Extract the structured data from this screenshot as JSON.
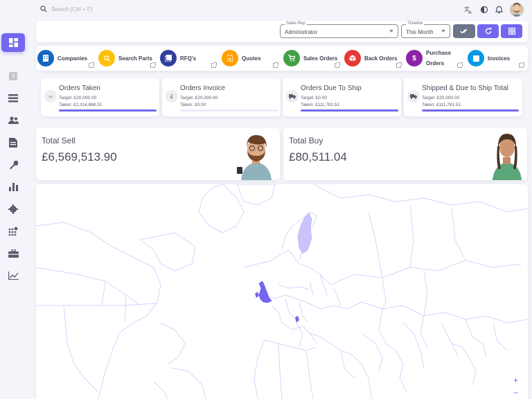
{
  "search": {
    "placeholder": "Search (Ctrl + F)"
  },
  "filters": {
    "sales_rep": {
      "label": "Sales Rep",
      "value": "Administrator"
    },
    "timeline": {
      "label": "Timeline",
      "value": "This Month"
    }
  },
  "quick_links": [
    {
      "label": "Companies",
      "color": "#1565c0",
      "icon": "building-icon"
    },
    {
      "label": "Search Parts",
      "color": "#ffc107",
      "icon": "search-icon"
    },
    {
      "label": "RFQ's",
      "color": "#303f9f",
      "icon": "stack-icon"
    },
    {
      "label": "Quotes",
      "color": "#ff9f00",
      "icon": "document-icon"
    },
    {
      "label": "Sales Orders",
      "color": "#43a047",
      "icon": "cart-icon"
    },
    {
      "label": "Back Orders",
      "color": "#e53935",
      "icon": "box-icon"
    },
    {
      "label": "Purchase Orders",
      "color": "#8e24aa",
      "icon": "dollar-icon"
    },
    {
      "label": "Invoices",
      "color": "#039be5",
      "icon": "invoice-icon"
    }
  ],
  "stats": [
    {
      "title": "Orders Taken",
      "target": "Target: £20,000.00",
      "taken": "Taken: £2,314,868.51",
      "icon": "code-icon",
      "progress": 1.0
    },
    {
      "title": "Orders Invoice",
      "target": "Target: £20,000.00",
      "taken": "Taken: £0.00",
      "icon": "pound-icon",
      "progress": 0.0
    },
    {
      "title": "Orders Due To Ship",
      "target": "Target: £0.00",
      "taken": "Taken: £111,781.51",
      "icon": "truck-icon",
      "progress": 1.0
    },
    {
      "title": "Shipped & Due to Ship Total",
      "target": "Target: £20,000.00",
      "taken": "Taken: £111,781.51",
      "icon": "truck-icon",
      "progress": 1.0
    }
  ],
  "totals": {
    "sell": {
      "label": "Total Sell",
      "value": "£6,569,513.90"
    },
    "buy": {
      "label": "Total Buy",
      "value": "£80,511.04"
    }
  },
  "map": {
    "zoom_in": "+",
    "zoom_out": "−",
    "highlight_color": "#7367f0",
    "light_color": "#c9c5fb"
  },
  "colors": {
    "accent": "#7367f0",
    "secondary": "#6d7588"
  }
}
